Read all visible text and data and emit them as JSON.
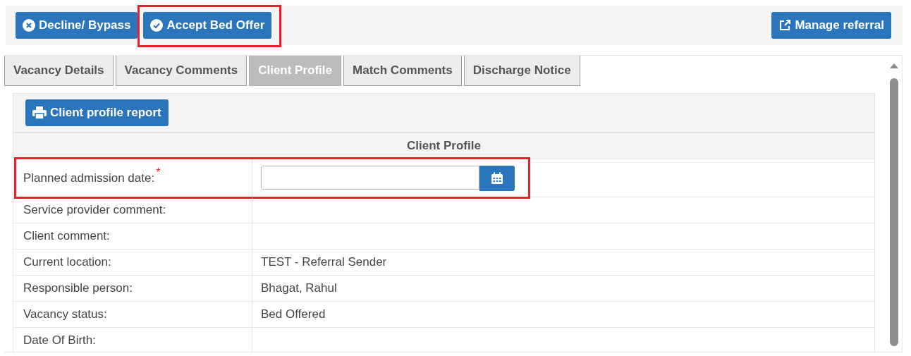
{
  "toolbar": {
    "left_buttons": [
      {
        "label": "Decline/ Bypass",
        "kind": "decline",
        "highlighted": false
      },
      {
        "label": "Accept Bed Offer",
        "kind": "accept",
        "highlighted": true
      }
    ],
    "right_button": {
      "label": "Manage referral"
    }
  },
  "tabs": [
    {
      "label": "Vacancy Details",
      "selected": false
    },
    {
      "label": "Vacancy Comments",
      "selected": false
    },
    {
      "label": "Client Profile",
      "selected": true
    },
    {
      "label": "Match Comments",
      "selected": false
    },
    {
      "label": "Discharge Notice",
      "selected": false
    }
  ],
  "report_button": {
    "label": "Client profile report"
  },
  "profile": {
    "heading": "Client Profile",
    "rows": [
      {
        "label": "Planned admission date:",
        "required": true,
        "required_mark": "*",
        "kind": "date",
        "highlighted": true
      },
      {
        "label": "Service provider comment:",
        "kind": "text"
      },
      {
        "label": "Client comment:",
        "kind": "text"
      },
      {
        "label": "Current location:",
        "kind": "text",
        "value": "TEST - Referral Sender"
      },
      {
        "label": "Responsible person:",
        "kind": "text",
        "value": "Bhagat, Rahul"
      },
      {
        "label": "Vacancy status:",
        "kind": "text",
        "value": "Bed Offered"
      },
      {
        "label": "Date Of Birth:",
        "kind": "text"
      }
    ]
  }
}
